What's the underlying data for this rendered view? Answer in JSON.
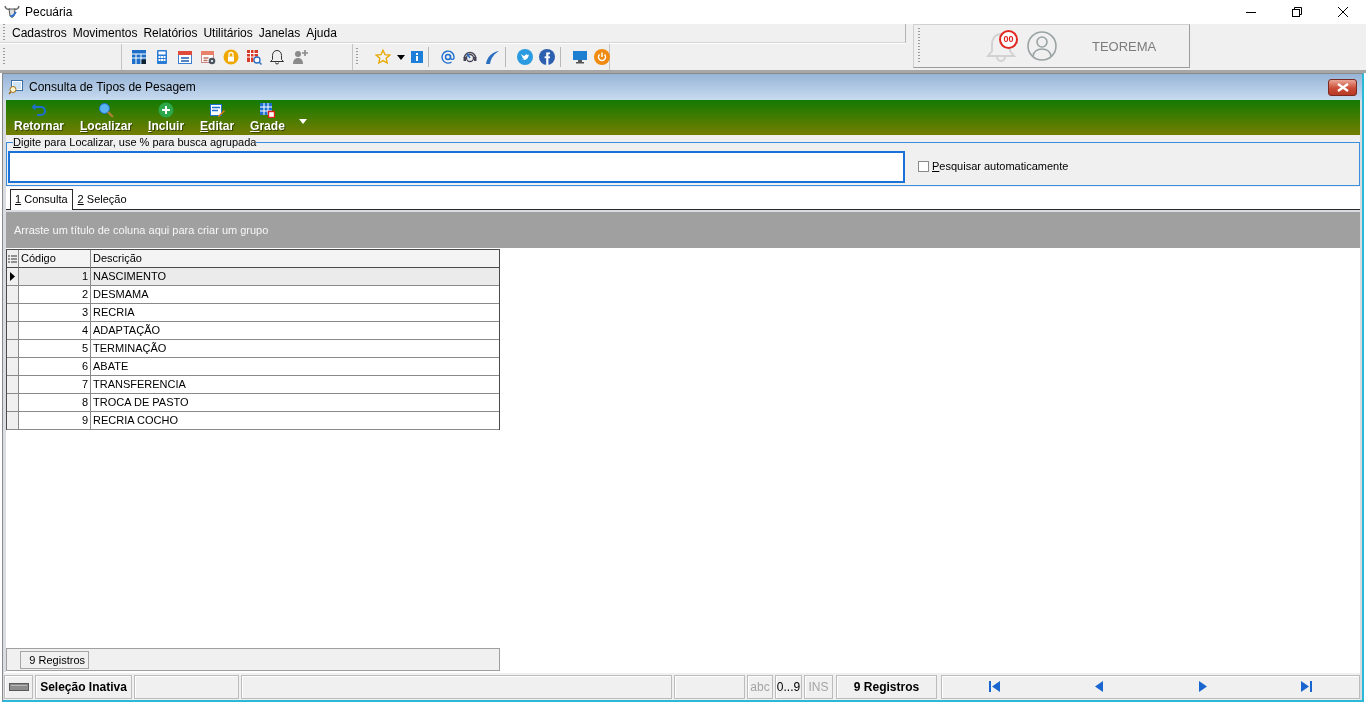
{
  "app": {
    "title": "Pecuária"
  },
  "menu": [
    {
      "label": "Cadastros"
    },
    {
      "label": "Movimentos"
    },
    {
      "label": "Relatórios"
    },
    {
      "label": "Utilitários"
    },
    {
      "label": "Janelas"
    },
    {
      "label": "Ajuda"
    }
  ],
  "user_panel": {
    "notification_count": "00",
    "user_name": "TEOREMA"
  },
  "child_window": {
    "title": "Consulta de Tipos de Pesagem"
  },
  "actions": [
    {
      "label": "Retornar",
      "kind": "back",
      "mnemonic": false
    },
    {
      "label": "Localizar",
      "kind": "find",
      "mnemonic": true
    },
    {
      "label": "Incluir",
      "kind": "add",
      "mnemonic": true
    },
    {
      "label": "Editar",
      "kind": "edit",
      "mnemonic": true
    },
    {
      "label": "Grade",
      "kind": "grid",
      "mnemonic": true
    }
  ],
  "search": {
    "label": "Digite para Localizar, use % para busca agrupada",
    "mnemonic": true
  },
  "auto_search": {
    "label": "Pesquisar automaticamente",
    "mnemonic": true,
    "checked": false
  },
  "tabs": [
    {
      "label": "1 Consulta",
      "selected": true,
      "mnemonic": true
    },
    {
      "label": "2 Seleção",
      "selected": false,
      "mnemonic": true
    }
  ],
  "group_panel": {
    "hint": "Arraste um título de coluna aqui para criar um grupo"
  },
  "table": {
    "columns": [
      "Código",
      "Descrição"
    ],
    "rows": [
      {
        "cells": [
          "1",
          "NASCIMENTO"
        ],
        "selected": true
      },
      {
        "cells": [
          "2",
          "DESMAMA"
        ],
        "selected": false
      },
      {
        "cells": [
          "3",
          "RECRIA"
        ],
        "selected": false
      },
      {
        "cells": [
          "4",
          "ADAPTAÇÃO"
        ],
        "selected": false
      },
      {
        "cells": [
          "5",
          "TERMINAÇÃO"
        ],
        "selected": false
      },
      {
        "cells": [
          "6",
          "ABATE"
        ],
        "selected": false
      },
      {
        "cells": [
          "7",
          "TRANSFERENCIA"
        ],
        "selected": false
      },
      {
        "cells": [
          "8",
          "TROCA DE PASTO"
        ],
        "selected": false
      },
      {
        "cells": [
          "9",
          "RECRIA COCHO"
        ],
        "selected": false
      }
    ]
  },
  "table_footer": {
    "record_count": "9 Registros"
  },
  "status_bar": {
    "selection": "Seleção Inativa",
    "indicators": [
      {
        "label": "abc",
        "on": false
      },
      {
        "label": "0...9",
        "on": true
      },
      {
        "label": "INS",
        "on": false
      }
    ],
    "record_count": "9 Registros"
  }
}
